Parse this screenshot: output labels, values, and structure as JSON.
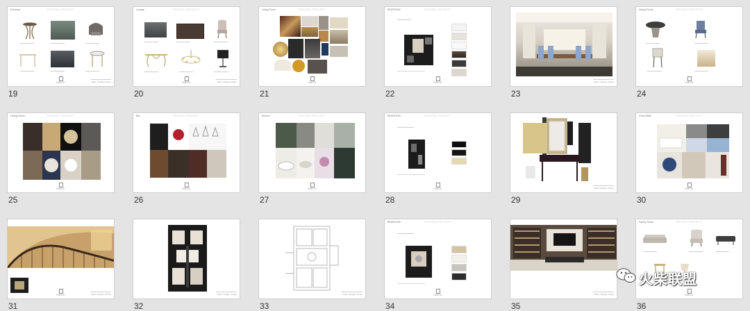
{
  "slides": [
    {
      "num": "19",
      "title": "FEDORA PROJECT",
      "header": "Entrance",
      "footer": "2021 / Design Library"
    },
    {
      "num": "20",
      "title": "FEDORA PROJECT",
      "header": "Lounge",
      "footer": "2021 / Design Library"
    },
    {
      "num": "21",
      "title": "FEDORA PROJECT",
      "header": "Living Room",
      "footer": ""
    },
    {
      "num": "22",
      "title": "FEDORA PROJECT",
      "header": "BEDROOM",
      "footer": ""
    },
    {
      "num": "23",
      "title": "",
      "header": "",
      "footer": "2021 / Design Library"
    },
    {
      "num": "24",
      "title": "FEDORA PROJECT",
      "header": "Dining Room",
      "footer": ""
    },
    {
      "num": "25",
      "title": "FEDORA PROJECT",
      "header": "Dining Room",
      "footer": ""
    },
    {
      "num": "26",
      "title": "FEDORA PROJECT",
      "header": "Bar",
      "footer": ""
    },
    {
      "num": "27",
      "title": "FEDORA PROJECT",
      "header": "Kitchen",
      "footer": ""
    },
    {
      "num": "28",
      "title": "FEDORA PROJECT",
      "header": "BEDROOM",
      "footer": ""
    },
    {
      "num": "29",
      "title": "",
      "header": "",
      "footer": "2021 / Design Library"
    },
    {
      "num": "30",
      "title": "FEDORA PROJECT",
      "header": "Guest Bath",
      "footer": ""
    },
    {
      "num": "31",
      "title": "",
      "header": "",
      "footer": "2021 / Design Library"
    },
    {
      "num": "32",
      "title": "",
      "header": "",
      "footer": "2021 / Design Library"
    },
    {
      "num": "33",
      "title": "",
      "header": "",
      "footer": "2021 / Design Library"
    },
    {
      "num": "34",
      "title": "FEDORA PROJECT",
      "header": "BEDROOM",
      "footer": ""
    },
    {
      "num": "35",
      "title": "",
      "header": "",
      "footer": "2021 / Design Library"
    },
    {
      "num": "36",
      "title": "FEDORA PROJECT",
      "header": "Family Room",
      "footer": ""
    }
  ],
  "logo_text": "HMCD",
  "watermark": "火柴联盟",
  "colors": {
    "background": "#e4e4e4",
    "slide": "#ffffff",
    "border": "#cfcfcf"
  }
}
